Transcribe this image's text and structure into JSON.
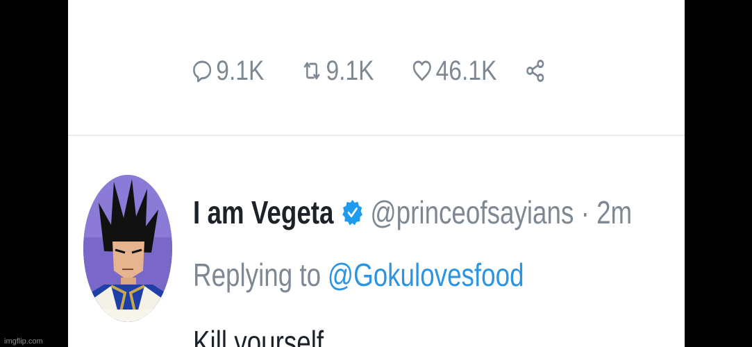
{
  "previous_tweet": {
    "cut_text": "",
    "actions": {
      "replies": "9.1K",
      "retweets": "9.1K",
      "likes": "46.1K"
    }
  },
  "reply_tweet": {
    "display_name": "I am Vegeta",
    "handle_time": "@princeofsayians · 2m",
    "replying_to_label": "Replying to",
    "replying_to_mention": "@Gokulovesfood",
    "text": "Kill yourself"
  },
  "icons": {
    "reply": "comment-icon",
    "retweet": "retweet-icon",
    "like": "heart-icon",
    "share": "share-icon",
    "verified": "verified-badge-icon"
  },
  "colors": {
    "muted": "#7d8893",
    "link": "#2c95e3",
    "verified": "#1d9bf0",
    "text": "#1b2229"
  },
  "watermark": "imgflip.com"
}
